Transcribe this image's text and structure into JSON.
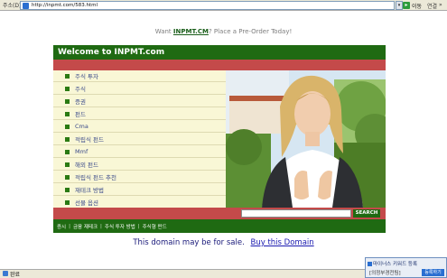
{
  "browser": {
    "address_label": "주소(D)",
    "url": "http://inpmt.com/583.html",
    "go_label": "이동",
    "links_label": "연결",
    "status_text": "완료"
  },
  "topline": {
    "prefix": "Want ",
    "domain": "INPMT.CM",
    "suffix": "? Place a Pre-Order Today!"
  },
  "header": {
    "title": "Welcome to INPMT.com"
  },
  "menu": [
    {
      "label": "주식 투자"
    },
    {
      "label": "주식"
    },
    {
      "label": "증권"
    },
    {
      "label": "펀드"
    },
    {
      "label": "Cma"
    },
    {
      "label": "적립식 펀드"
    },
    {
      "label": "Mmf"
    },
    {
      "label": "해외 펀드"
    },
    {
      "label": "적립식 펀드 추천"
    },
    {
      "label": "재테크 방법"
    },
    {
      "label": "선물 옵션"
    }
  ],
  "search": {
    "button_label": "SEARCH",
    "value": ""
  },
  "footer_links": [
    {
      "label": "증시"
    },
    {
      "label": "금융 재테크"
    },
    {
      "label": "주식 투자 방법"
    },
    {
      "label": "주식형 펀드"
    }
  ],
  "footer_sep": "|",
  "sale": {
    "text": "This domain may be for sale.",
    "link": "Buy this Domain"
  },
  "popup": {
    "title": "마이너스 키워드 등록",
    "subtitle": "[의정부경전팀]",
    "button_label": "등록하기"
  },
  "colors": {
    "header_green": "#1f6a12",
    "band_red": "#c44a4a",
    "menu_bg": "#f9f7d6",
    "menu_text": "#3a4a8a"
  }
}
